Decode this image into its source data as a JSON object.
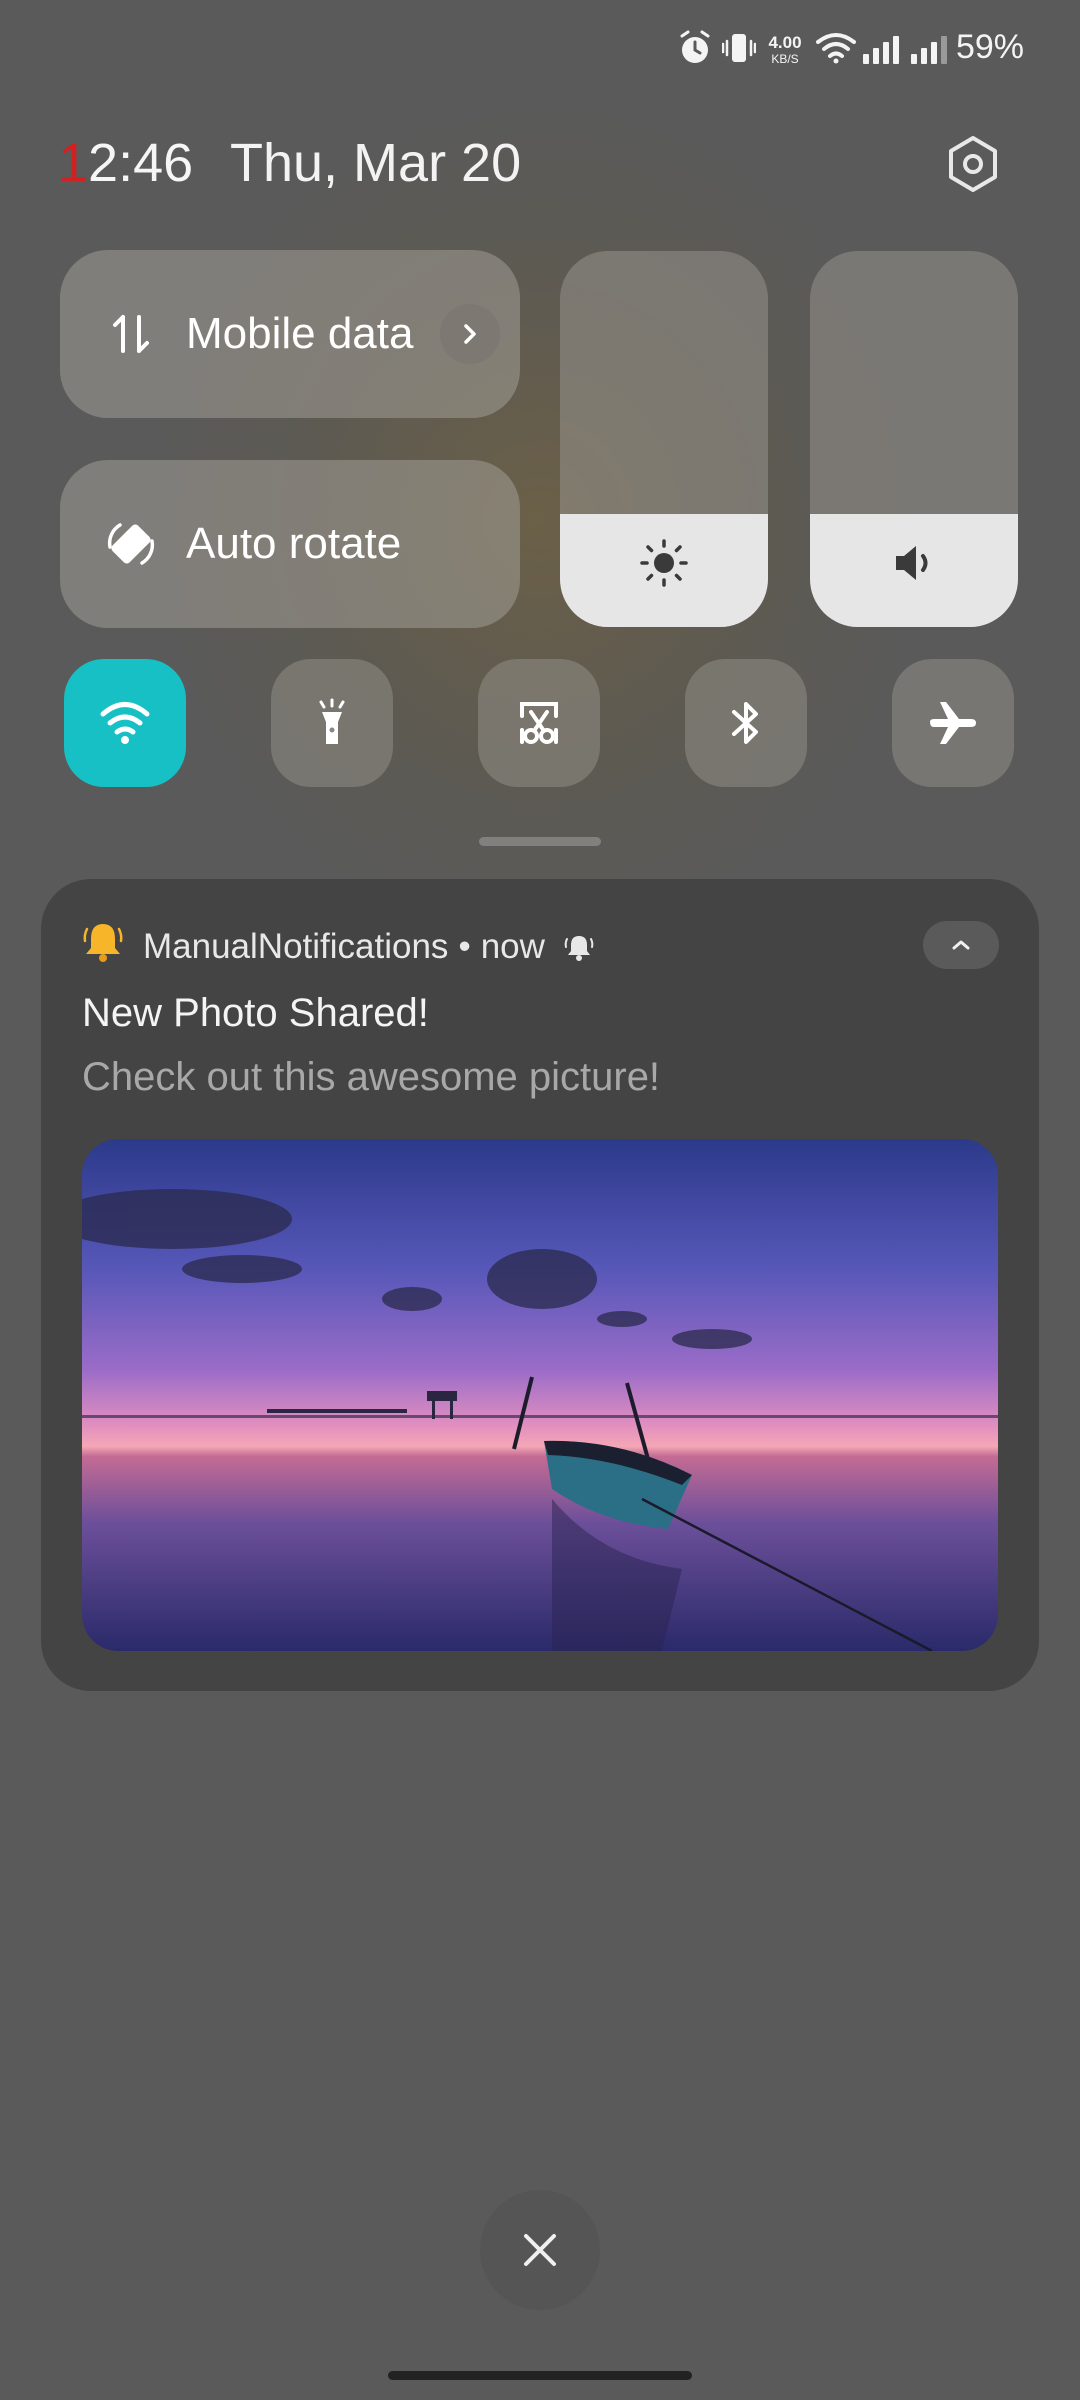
{
  "status_bar": {
    "net_speed_value": "4.00",
    "net_speed_unit": "KB/S",
    "battery": "59%",
    "icons": [
      "alarm-icon",
      "vibrate-icon",
      "wifi-signal-icon",
      "cell-signal-icon",
      "cell-signal-icon"
    ]
  },
  "header": {
    "time_first": "1",
    "time_rest": "2:46",
    "date": "Thu, Mar 20",
    "settings_icon": "gear-icon"
  },
  "tiles": {
    "mobile_data": {
      "label": "Mobile data",
      "icon": "data-arrows-icon"
    },
    "auto_rotate": {
      "label": "Auto rotate",
      "icon": "rotate-icon"
    }
  },
  "sliders": {
    "brightness": {
      "icon": "sun-icon",
      "level": 0.3
    },
    "volume": {
      "icon": "speaker-icon",
      "level": 0.3
    }
  },
  "quick_toggles": [
    {
      "name": "wifi",
      "icon": "wifi-icon",
      "active": true
    },
    {
      "name": "flashlight",
      "icon": "flashlight-icon",
      "active": false
    },
    {
      "name": "screenshot",
      "icon": "screenshot-icon",
      "active": false
    },
    {
      "name": "bluetooth",
      "icon": "bluetooth-icon",
      "active": false
    },
    {
      "name": "airplane",
      "icon": "airplane-icon",
      "active": false
    }
  ],
  "notification": {
    "app_name": "ManualNotifications",
    "separator": "•",
    "time": "now",
    "title": "New Photo Shared!",
    "body": "Check out this awesome picture!"
  },
  "colors": {
    "wifi_active": "#17c0c4",
    "card_bg": "#444444",
    "clock_accent": "#d32020"
  }
}
